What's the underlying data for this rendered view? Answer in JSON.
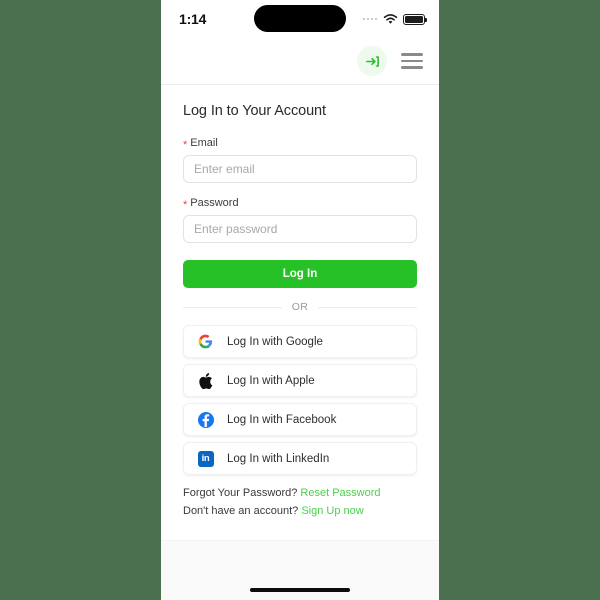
{
  "backdrop_color": "#4a7050",
  "accent_color": "#25c127",
  "link_color": "#4cd04c",
  "status_bar": {
    "time": "1:14",
    "signal_icon": "signal-dots-icon",
    "wifi_icon": "wifi-icon",
    "battery_icon": "battery-full-icon"
  },
  "header": {
    "login_icon": "login-arrow-icon",
    "menu_icon": "hamburger-menu-icon"
  },
  "main": {
    "title": "Log In to Your Account",
    "required_marker": "*",
    "email": {
      "label": "Email",
      "placeholder": "Enter email",
      "value": ""
    },
    "password": {
      "label": "Password",
      "placeholder": "Enter password",
      "value": ""
    },
    "submit_label": "Log In",
    "divider_label": "OR",
    "social_buttons": [
      {
        "label": "Log In with Google",
        "icon": "google-icon"
      },
      {
        "label": "Log In with Apple",
        "icon": "apple-icon"
      },
      {
        "label": "Log In with Facebook",
        "icon": "facebook-icon"
      },
      {
        "label": "Log In with LinkedIn",
        "icon": "linkedin-icon"
      }
    ],
    "footer": {
      "forgot_text": "Forgot Your Password?",
      "forgot_link": "Reset Password",
      "signup_text": "Don't have an account?",
      "signup_link": "Sign Up now"
    }
  },
  "bottom": {
    "home_indicator": "home-indicator"
  }
}
